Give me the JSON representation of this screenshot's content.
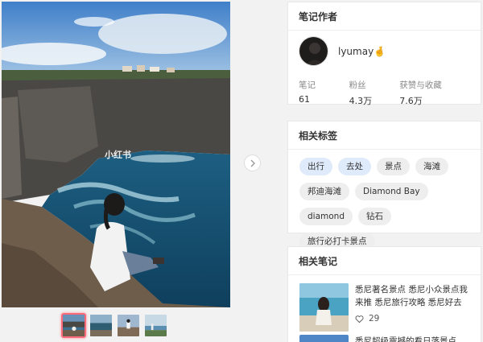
{
  "photo": {
    "watermark": "小红书"
  },
  "thumbnails": {
    "count": 4,
    "active_index": 0
  },
  "author_card": {
    "title": "笔记作者",
    "name": "lyumay",
    "emoji": "🤞",
    "stats": [
      {
        "label": "笔记",
        "value": "61"
      },
      {
        "label": "粉丝",
        "value": "4.3万"
      },
      {
        "label": "获赞与收藏",
        "value": "7.6万"
      }
    ]
  },
  "tags_card": {
    "title": "相关标签",
    "tags": [
      "出行",
      "去处",
      "景点",
      "海滩",
      "邦迪海滩",
      "Diamond Bay",
      "diamond",
      "钻石",
      "旅行必打卡景点"
    ]
  },
  "notes_card": {
    "title": "相关笔记",
    "notes": [
      {
        "title": "悉尼著名景点 悉尼小众景点我来推 悉尼旅行攻略 悉尼好去",
        "likes": "29"
      },
      {
        "title": "悉尼超级震撼的看日落景点"
      }
    ]
  },
  "colors": {
    "highlight_tag": "#dfeafa",
    "active_thumb_border": "#ff6b7a"
  }
}
